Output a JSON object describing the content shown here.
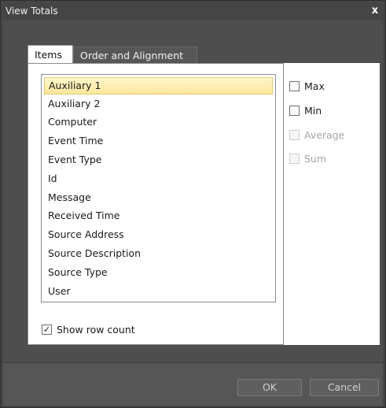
{
  "window": {
    "title": "View Totals",
    "close_glyph": "x"
  },
  "tabs": [
    {
      "label": "Items",
      "active": true
    },
    {
      "label": "Order and Alignment",
      "active": false
    }
  ],
  "items_list": {
    "items": [
      {
        "label": "Auxiliary 1",
        "selected": true
      },
      {
        "label": "Auxiliary 2"
      },
      {
        "label": "Computer"
      },
      {
        "label": "Event Time"
      },
      {
        "label": "Event Type"
      },
      {
        "label": "Id"
      },
      {
        "label": "Message"
      },
      {
        "label": "Received Time"
      },
      {
        "label": "Source Address"
      },
      {
        "label": "Source Description"
      },
      {
        "label": "Source Type"
      },
      {
        "label": "User"
      }
    ]
  },
  "aggregates": [
    {
      "label": "Max",
      "checked": false,
      "enabled": true
    },
    {
      "label": "Min",
      "checked": false,
      "enabled": true
    },
    {
      "label": "Average",
      "checked": false,
      "enabled": false
    },
    {
      "label": "Sum",
      "checked": false,
      "enabled": false
    }
  ],
  "show_row_count": {
    "label": "Show row count",
    "checked": true,
    "check_glyph": "✓"
  },
  "buttons": {
    "ok": "OK",
    "cancel": "Cancel"
  },
  "colors": {
    "selection": "#fde79a",
    "frame": "#454545",
    "panel": "#ffffff"
  }
}
